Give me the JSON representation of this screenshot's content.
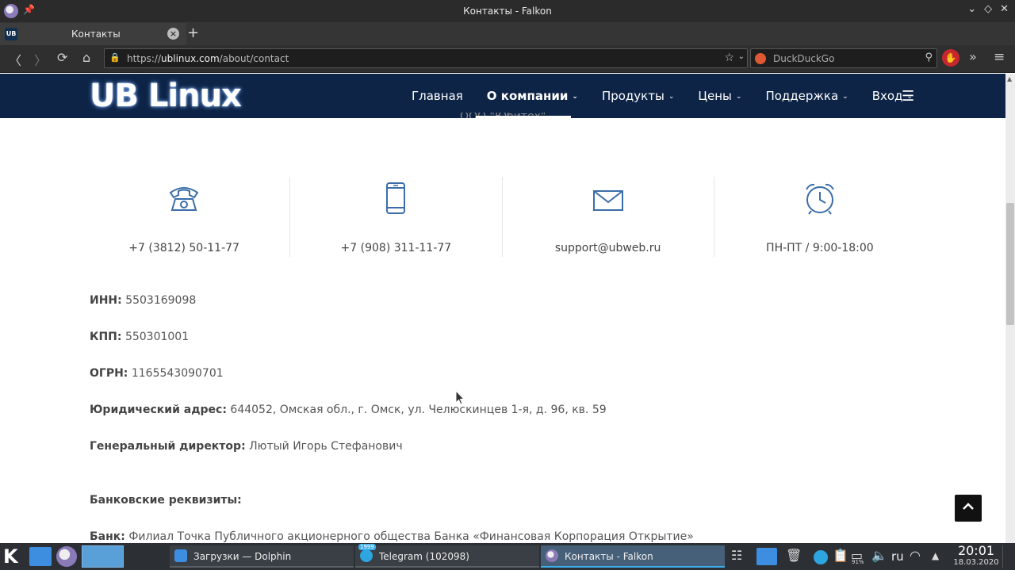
{
  "window": {
    "title": "Контакты - Falkon"
  },
  "tab": {
    "favicon_text": "UB",
    "label": "Контакты"
  },
  "urlbar": {
    "scheme": "https://",
    "host": "ublinux.com",
    "path": "/about/contact"
  },
  "searchbar": {
    "placeholder": "DuckDuckGo"
  },
  "site": {
    "logo": "UB Linux",
    "nav": [
      {
        "label": "Главная"
      },
      {
        "label": "О компании"
      },
      {
        "label": "Продукты"
      },
      {
        "label": "Цены"
      },
      {
        "label": "Поддержка"
      },
      {
        "label": "Вход"
      }
    ],
    "partial_text": "ООО \"Юбитех\""
  },
  "contacts": [
    {
      "icon": "telephone-icon",
      "value": "+7 (3812) 50-11-77"
    },
    {
      "icon": "mobile-phone-icon",
      "value": "+7 (908) 311-11-77"
    },
    {
      "icon": "envelope-icon",
      "value": "support@ubweb.ru"
    },
    {
      "icon": "alarm-clock-icon",
      "value": "ПН-ПТ / 9:00-18:00"
    }
  ],
  "details": {
    "inn_label": "ИНН:",
    "inn": "5503169098",
    "kpp_label": "КПП:",
    "kpp": "550301001",
    "ogrn_label": "ОГРН:",
    "ogrn": "1165543090701",
    "address_label": "Юридический адрес:",
    "address": "644052, Омская обл., г. Омск, ул. Челюскинцев 1-я, д. 96, кв. 59",
    "director_label": "Генеральный директор:",
    "director": "Лютый Игорь Стефанович",
    "bank_heading": "Банковские реквизиты:",
    "bank_label": "Банк:",
    "bank": "Филиал Точка Публичного акционерного общества Банка «Финансовая Корпорация Открытие»"
  },
  "taskbar": {
    "tasks": [
      {
        "label": "Загрузки — Dolphin",
        "active": false
      },
      {
        "label": "Telegram (102098)",
        "active": false,
        "badge": "1999"
      },
      {
        "label": "Контакты - Falkon",
        "active": true
      }
    ],
    "language": "ru",
    "battery": "91%",
    "time": "20:01",
    "date": "18.03.2020"
  },
  "colors": {
    "site_header": "#0d2447",
    "icon_blue": "#3b6ea8",
    "active_task_accent": "#3daee9"
  }
}
